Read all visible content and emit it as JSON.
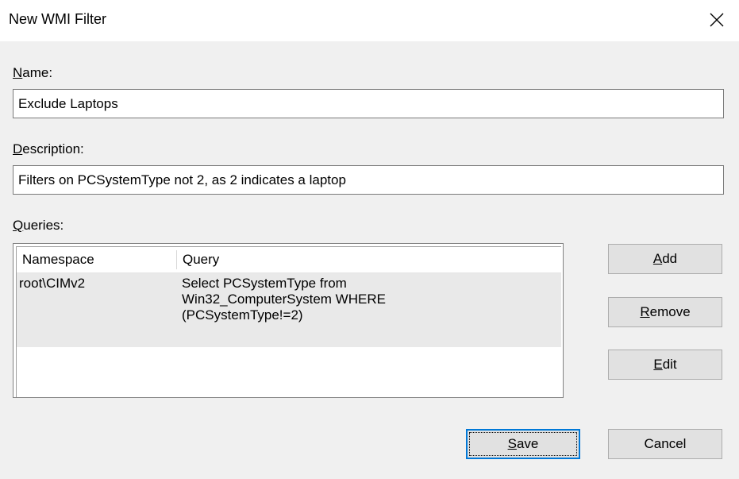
{
  "window": {
    "title": "New WMI Filter"
  },
  "name": {
    "label_first": "N",
    "label_rest": "ame:",
    "value": "Exclude Laptops"
  },
  "description": {
    "label_first": "D",
    "label_rest": "escription:",
    "value": "Filters on PCSystemType not 2, as 2 indicates a laptop"
  },
  "queries": {
    "label_first": "Q",
    "label_rest": "ueries:",
    "columns": [
      "Namespace",
      "Query"
    ],
    "rows": [
      {
        "namespace": "root\\CIMv2",
        "query_lines": [
          "Select PCSystemType from",
          "Win32_ComputerSystem WHERE",
          "(PCSystemType!=2)"
        ]
      }
    ]
  },
  "buttons": {
    "add": {
      "first": "A",
      "rest": "dd"
    },
    "remove": {
      "first": "R",
      "rest": "emove"
    },
    "edit": {
      "first": "E",
      "rest": "dit"
    },
    "save": {
      "first": "S",
      "rest": "ave"
    },
    "cancel": {
      "label": "Cancel"
    }
  },
  "icons": {
    "close": "close-icon"
  }
}
